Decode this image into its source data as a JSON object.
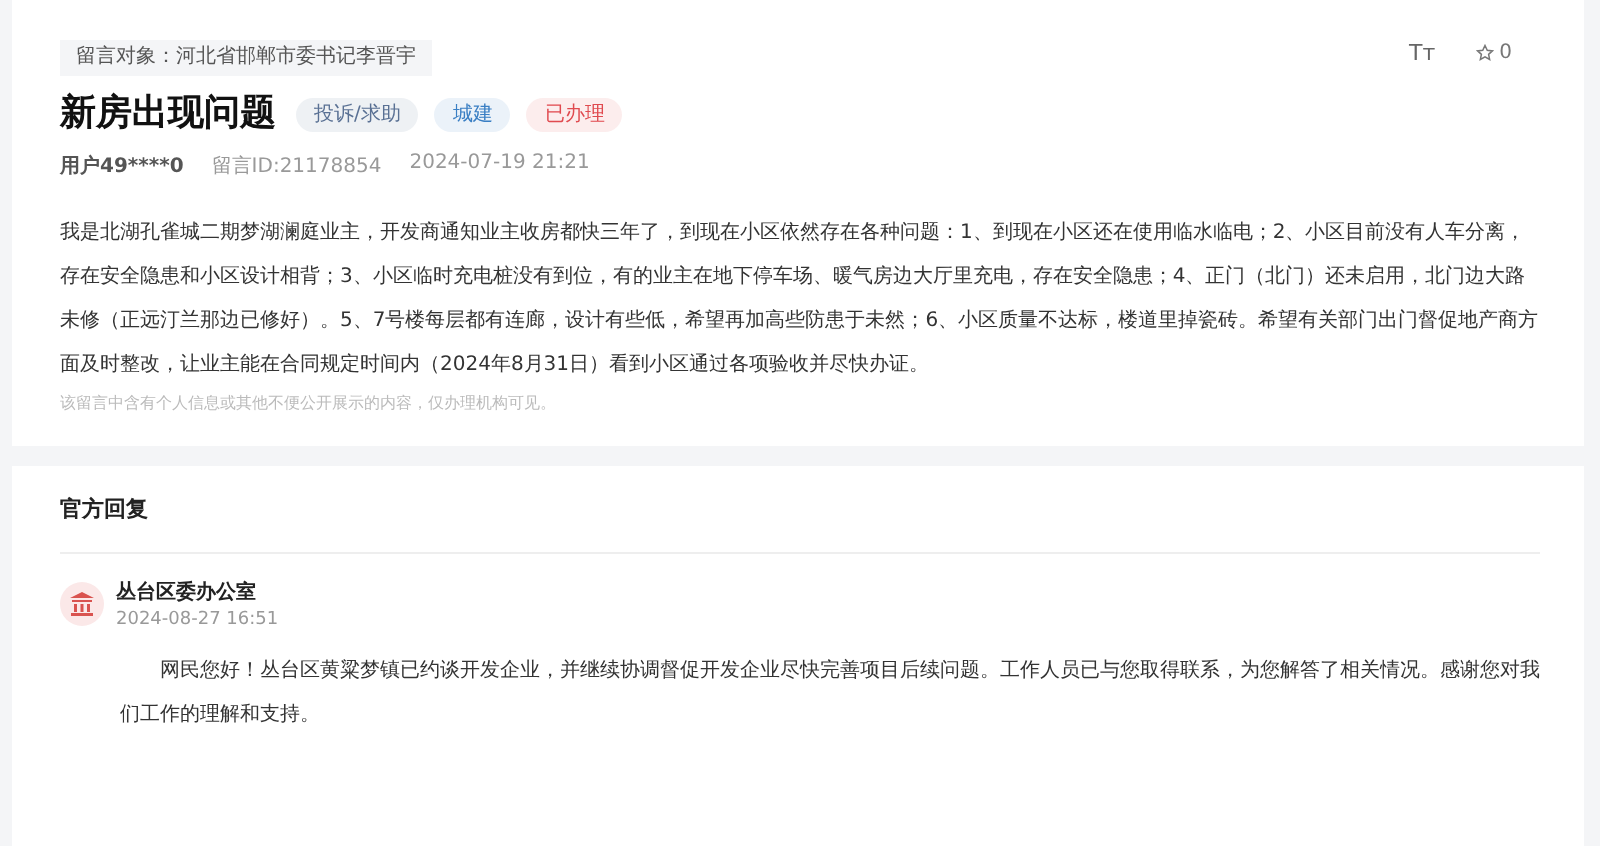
{
  "message": {
    "target_label": "留言对象：河北省邯郸市委书记李晋宇",
    "title": "新房出现问题",
    "tags": [
      {
        "label": "投诉/求助",
        "color": "#5a7194"
      },
      {
        "label": "城建",
        "color": "#3a7fc4"
      },
      {
        "label": "已办理",
        "color": "#e04a4f"
      }
    ],
    "font_toggle": "Tт",
    "favorite_count": "0",
    "user": "用户49****0",
    "message_id": "留言ID:21178854",
    "time": "2024-07-19 21:21",
    "body": "我是北湖孔雀城二期梦湖澜庭业主，开发商通知业主收房都快三年了，到现在小区依然存在各种问题：1、到现在小区还在使用临水临电；2、小区目前没有人车分离，存在安全隐患和小区设计相背；3、小区临时充电桩没有到位，有的业主在地下停车场、暖气房边大厅里充电，存在安全隐患；4、正门（北门）还未启用，北门边大路未修（正远汀兰那边已修好）。5、7号楼每层都有连廊，设计有些低，希望再加高些防患于未然；6、小区质量不达标，楼道里掉瓷砖。希望有关部门出门督促地产商方面及时整改，让业主能在合同规定时间内（2024年8月31日）看到小区通过各项验收并尽快办证。",
    "privacy_note": "该留言中含有个人信息或其他不便公开展示的内容，仅办理机构可见。"
  },
  "reply": {
    "heading": "官方回复",
    "office": "丛台区委办公室",
    "time": "2024-08-27 16:51",
    "body": "网民您好！丛台区黄粱梦镇已约谈开发企业，并继续协调督促开发企业尽快完善项目后续问题。工作人员已与您取得联系，为您解答了相关情况。感谢您对我们工作的理解和支持。"
  }
}
